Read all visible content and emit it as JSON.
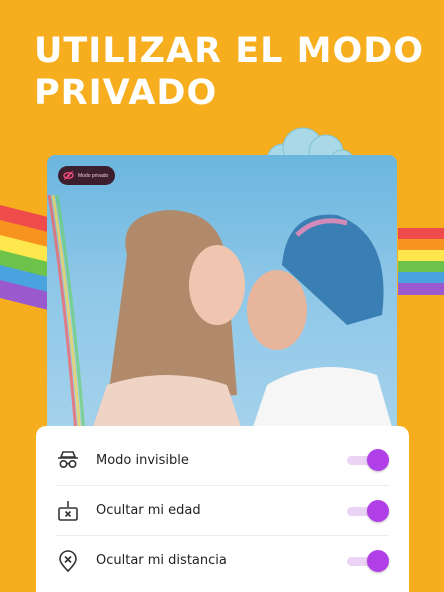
{
  "headline": {
    "line1": "UTILIZAR EL MODO",
    "line2": "PRIVADO"
  },
  "photo": {
    "private_badge_label": "Modo privado",
    "private_badge_icon": "eye-slash-icon"
  },
  "settings": [
    {
      "label": "Modo invisible",
      "icon": "incognito-glasses-icon",
      "enabled": true
    },
    {
      "label": "Ocultar mi edad",
      "icon": "age-cake-hidden-icon",
      "enabled": true
    },
    {
      "label": "Ocultar mi distancia",
      "icon": "location-pin-x-icon",
      "enabled": true
    }
  ],
  "colors": {
    "background": "#F6AE1E",
    "accent": "#B13FE8",
    "toggle_track": "#EAD3F4",
    "panel": "#FFFFFF"
  }
}
